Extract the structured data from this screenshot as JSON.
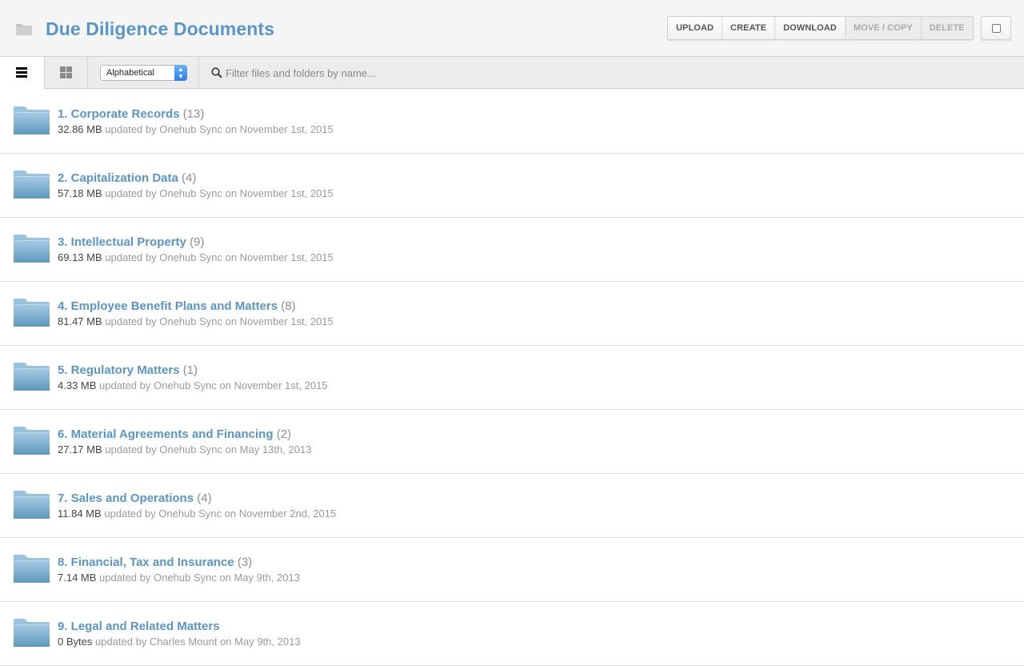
{
  "header": {
    "icon": "folder-icon",
    "title": "Due Diligence Documents",
    "buttons": [
      {
        "label": "UPLOAD",
        "enabled": true
      },
      {
        "label": "CREATE",
        "enabled": true
      },
      {
        "label": "DOWNLOAD",
        "enabled": true
      },
      {
        "label": "MOVE / COPY",
        "enabled": false
      },
      {
        "label": "DELETE",
        "enabled": false
      }
    ],
    "select_all_checked": false
  },
  "toolbar": {
    "view_modes": [
      {
        "icon": "list-view-icon",
        "active": true
      },
      {
        "icon": "grid-view-icon",
        "active": false
      }
    ],
    "sort": {
      "selected": "Alphabetical"
    },
    "filter": {
      "icon": "search-icon",
      "value": "",
      "placeholder": "Filter files and folders by name..."
    }
  },
  "colors": {
    "accent": "#5b95c5",
    "folder": "#7fb3d3"
  },
  "folders": [
    {
      "name": "1. Corporate Records",
      "count": "(13)",
      "size": "32.86 MB",
      "meta": "updated by Onehub Sync on November 1st, 2015"
    },
    {
      "name": "2. Capitalization Data",
      "count": "(4)",
      "size": "57.18 MB",
      "meta": "updated by Onehub Sync on November 1st, 2015"
    },
    {
      "name": "3. Intellectual Property",
      "count": "(9)",
      "size": "69.13 MB",
      "meta": "updated by Onehub Sync on November 1st, 2015"
    },
    {
      "name": "4. Employee Benefit Plans and Matters",
      "count": "(8)",
      "size": "81.47 MB",
      "meta": "updated by Onehub Sync on November 1st, 2015"
    },
    {
      "name": "5. Regulatory Matters",
      "count": "(1)",
      "size": "4.33 MB",
      "meta": "updated by Onehub Sync on November 1st, 2015"
    },
    {
      "name": "6. Material Agreements and Financing",
      "count": "(2)",
      "size": "27.17 MB",
      "meta": "updated by Onehub Sync on May 13th, 2013"
    },
    {
      "name": "7. Sales and Operations",
      "count": "(4)",
      "size": "11.84 MB",
      "meta": "updated by Onehub Sync on November 2nd, 2015"
    },
    {
      "name": "8. Financial, Tax and Insurance",
      "count": "(3)",
      "size": "7.14 MB",
      "meta": "updated by Onehub Sync on May 9th, 2013"
    },
    {
      "name": "9. Legal and Related Matters",
      "count": "",
      "size": "0 Bytes",
      "meta": "updated by Charles Mount on May 9th, 2013"
    }
  ]
}
